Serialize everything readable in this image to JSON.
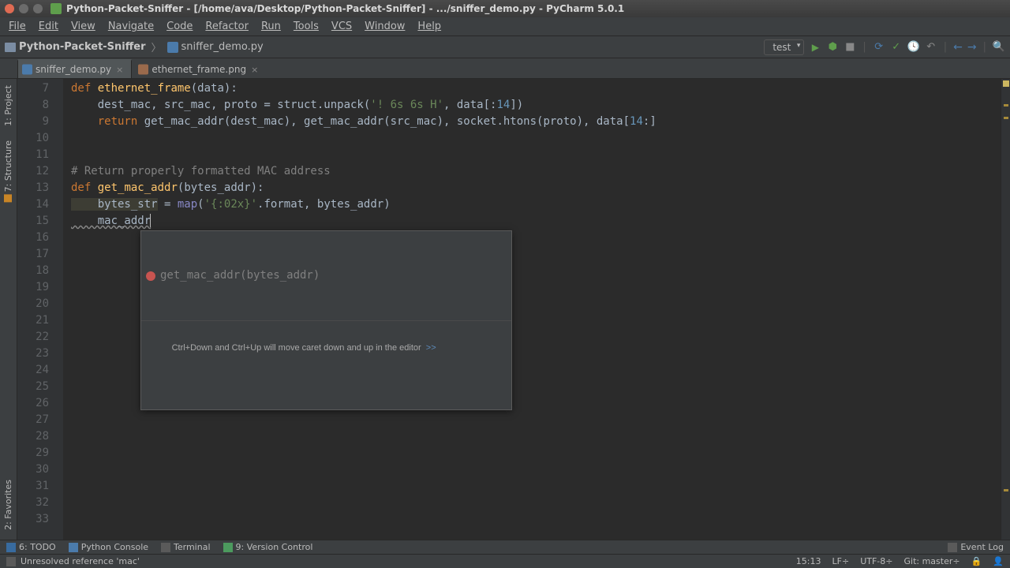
{
  "title": "Python-Packet-Sniffer - [/home/ava/Desktop/Python-Packet-Sniffer] - .../sniffer_demo.py - PyCharm 5.0.1",
  "menu": [
    "File",
    "Edit",
    "View",
    "Navigate",
    "Code",
    "Refactor",
    "Run",
    "Tools",
    "VCS",
    "Window",
    "Help"
  ],
  "breadcrumb": {
    "root": "Python-Packet-Sniffer",
    "file": "sniffer_demo.py"
  },
  "run_config": "test",
  "tabs": [
    {
      "label": "sniffer_demo.py",
      "kind": "py",
      "active": true
    },
    {
      "label": "ethernet_frame.png",
      "kind": "png",
      "active": false
    }
  ],
  "sidebar": {
    "project": "1: Project",
    "structure": "7: Structure",
    "favorites": "2: Favorites"
  },
  "gutter_start": 7,
  "gutter_end": 33,
  "code": {
    "l7_def": "def",
    "l7_fn": "ethernet_frame",
    "l7_rest": "(data):",
    "l8": "    dest_mac, src_mac, proto = struct.unpack(",
    "l8_str": "'! 6s 6s H'",
    "l8_tail": ", data[:",
    "l8_num": "14",
    "l8_close": "])",
    "l9_ret": "return",
    "l9a": " get_mac_addr(dest_mac), get_mac_addr(src_mac), socket.htons(proto), data[",
    "l9_num": "14",
    "l9_tail": ":]",
    "l12_cmt": "# Return properly formatted MAC address",
    "l13_def": "def",
    "l13_fn": "get_mac_addr",
    "l13_rest": "(bytes_addr):",
    "l14a": "    bytes_str",
    "l14b": " = ",
    "l14_map": "map",
    "l14c": "(",
    "l14_str": "'{:02x}'",
    "l14d": ".format, bytes_addr)",
    "l15": "    mac_addr"
  },
  "popup": {
    "suggestion": "get_mac_addr(bytes_addr)",
    "hint": "Ctrl+Down and Ctrl+Up will move caret down and up in the editor",
    "link": ">>"
  },
  "bottom": {
    "todo": "6: TODO",
    "py": "Python Console",
    "term": "Terminal",
    "vc": "9: Version Control",
    "log": "Event Log"
  },
  "status": {
    "msg": "Unresolved reference 'mac'",
    "pos": "15:13",
    "lf": "LF÷",
    "enc": "UTF-8÷",
    "git": "Git: master÷"
  }
}
